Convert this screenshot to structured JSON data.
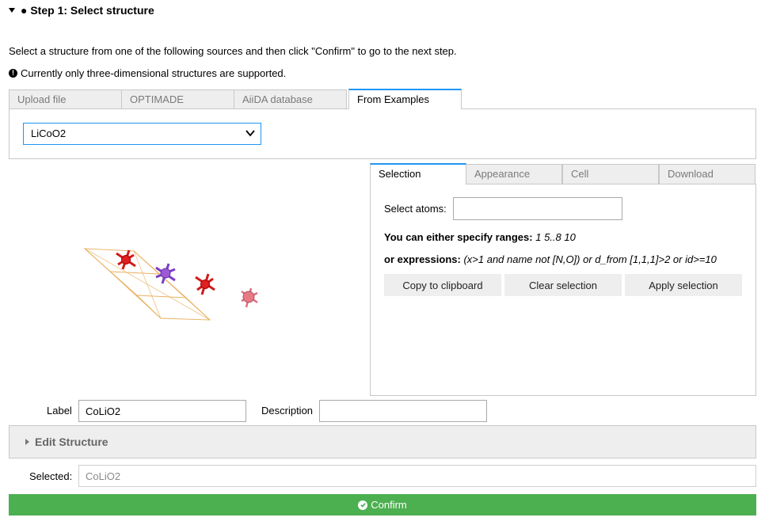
{
  "step": {
    "title": "● Step 1: Select structure"
  },
  "intro": "Select a structure from one of the following sources and then click \"Confirm\" to go to the next step.",
  "note": "Currently only three-dimensional structures are supported.",
  "source_tabs": [
    {
      "label": "Upload file",
      "active": false
    },
    {
      "label": "OPTIMADE",
      "active": false
    },
    {
      "label": "AiiDA database",
      "active": false
    },
    {
      "label": "From Examples",
      "active": true
    }
  ],
  "example_select": {
    "value": "LiCoO2"
  },
  "right_tabs": [
    {
      "label": "Selection",
      "active": true
    },
    {
      "label": "Appearance",
      "active": false
    },
    {
      "label": "Cell",
      "active": false
    },
    {
      "label": "Download",
      "active": false
    }
  ],
  "selection": {
    "select_atoms_label": "Select atoms:",
    "select_atoms_value": "",
    "ranges_label": "You can either specify ranges:",
    "ranges_example": "1 5..8 10",
    "expressions_label": "or expressions:",
    "expressions_example": "(x>1 and name not [N,O]) or d_from [1,1,1]>2 or id>=10",
    "buttons": {
      "copy": "Copy to clipboard",
      "clear": "Clear selection",
      "apply": "Apply selection"
    }
  },
  "structure_info": {
    "label_text": "Label",
    "label_value": "CoLiO2",
    "description_text": "Description",
    "description_value": ""
  },
  "edit_structure": {
    "label": "Edit Structure"
  },
  "selected": {
    "label": "Selected:",
    "value": "CoLiO2"
  },
  "confirm": {
    "label": "Confirm"
  },
  "colors": {
    "accent": "#2196f3",
    "confirm": "#4caf50",
    "atom_co": "#e02020",
    "atom_li": "#9b59d6",
    "atom_o": "#e87a85",
    "cell_edge": "#e8b060"
  }
}
